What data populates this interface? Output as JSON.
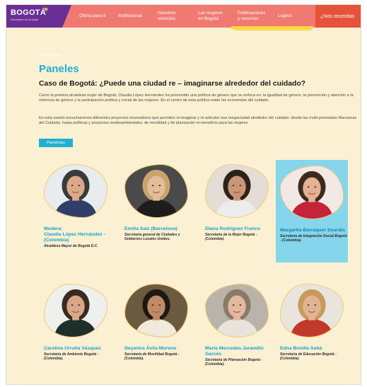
{
  "header": {
    "logo": {
      "main": "BOGOTÁ",
      "sub": "Secretaría de la Mujer"
    },
    "nav": [
      {
        "label": "Oferta para ti"
      },
      {
        "label": "Institucional"
      },
      {
        "label": "Nuestros\nservicios"
      },
      {
        "label": "Las mujeres\nen Bogotá"
      },
      {
        "label": "Publicaciones\ny recursos"
      },
      {
        "label": "Logros"
      }
    ],
    "cta": "¿Nos necesitas"
  },
  "main": {
    "section_title": "Paneles",
    "case_title": "Caso de Bogotá: ¿Puede una ciudad re – imaginarse alrededor del cuidado?",
    "paragraph_1": "Como la primera alcaldesa mujer de Bogotá, Claudia López Hernández ha promovido una política de género que se enfoca en: la igualdad de género, la prevención y atención a la violencia de género y la participación política y social de las mujeres. En el centro de esta política están las economías del cuidado.",
    "paragraph_2": "En esta sesión escucharemos diferentes proyectos innovadores que permiten re-imaginar y re-articular una megaciudad alrededor del cuidado: desde las multi-premiadas Manzanas del Cuidado, hasta políticas y proyectos medioambientales, de movilidad y de planeación en beneficio para las mujeres",
    "panelists_button": "Panelistas"
  },
  "panelists": [
    {
      "name": "Modera:\nClaudia López Hernández - (Colombia)",
      "role": "Alcaldesa Mayor de Bogotá D.C.",
      "highlight": false,
      "skin": "#d9a98a",
      "hair": "#3a3a3a",
      "clothes": "#2f3f6a",
      "bg": "#e8ecef"
    },
    {
      "name": "Emilia Saiz  (Barcelona)",
      "role": "Secretaria general de Ciudades y Gobiernos Locales Unidos.",
      "highlight": false,
      "skin": "#e6bd9a",
      "hair": "#c9a56e",
      "clothes": "#1d1d1d",
      "bg": "#4a4a4a"
    },
    {
      "name": "Diana Rodríguez Franco",
      "role": "Secretaria de la Mujer Bogotá - (Colombia).",
      "highlight": false,
      "skin": "#c99677",
      "hair": "#2e221a",
      "clothes": "#ececec",
      "bg": "#e3ddd5"
    },
    {
      "name": "Margarita Barraquer Sourdis",
      "role": "Secretaria de Integración Social Bogotá - (Colombia).",
      "highlight": true,
      "skin": "#e3b293",
      "hair": "#3d2a1e",
      "clothes": "#c5233a",
      "bg": "#f2e9e6"
    },
    {
      "name": "Carolina Urrutia Vásquez",
      "role": "Secretaria de Ambiente Bogotá - (Colombia).",
      "highlight": false,
      "skin": "#d8a788",
      "hair": "#3a2a20",
      "clothes": "#1e2e2a",
      "bg": "#eef0ee"
    },
    {
      "name": "Deyanira Ávila Moreno",
      "role": "Secretaria de Movilidad Bogotá - (Colombia).",
      "highlight": false,
      "skin": "#bf8a68",
      "hair": "#1e1712",
      "clothes": "#f1e9d9",
      "bg": "#6b5a3e"
    },
    {
      "name": "María Mercedes Jaramillo Garcés",
      "role": "Secretaria de Planeación Bogotá - (Colombia).",
      "highlight": false,
      "skin": "#e0b99f",
      "hair": "#8b7a68",
      "clothes": "#e8e3db",
      "bg": "#b9b3aa"
    },
    {
      "name": "Edna Bonilla Sebá",
      "role": "Secretaria de Educación Bogotá - (Colombia).",
      "highlight": false,
      "skin": "#e3b492",
      "hair": "#c99a5a",
      "clothes": "#c0392b",
      "bg": "#e9e4dc"
    }
  ]
}
